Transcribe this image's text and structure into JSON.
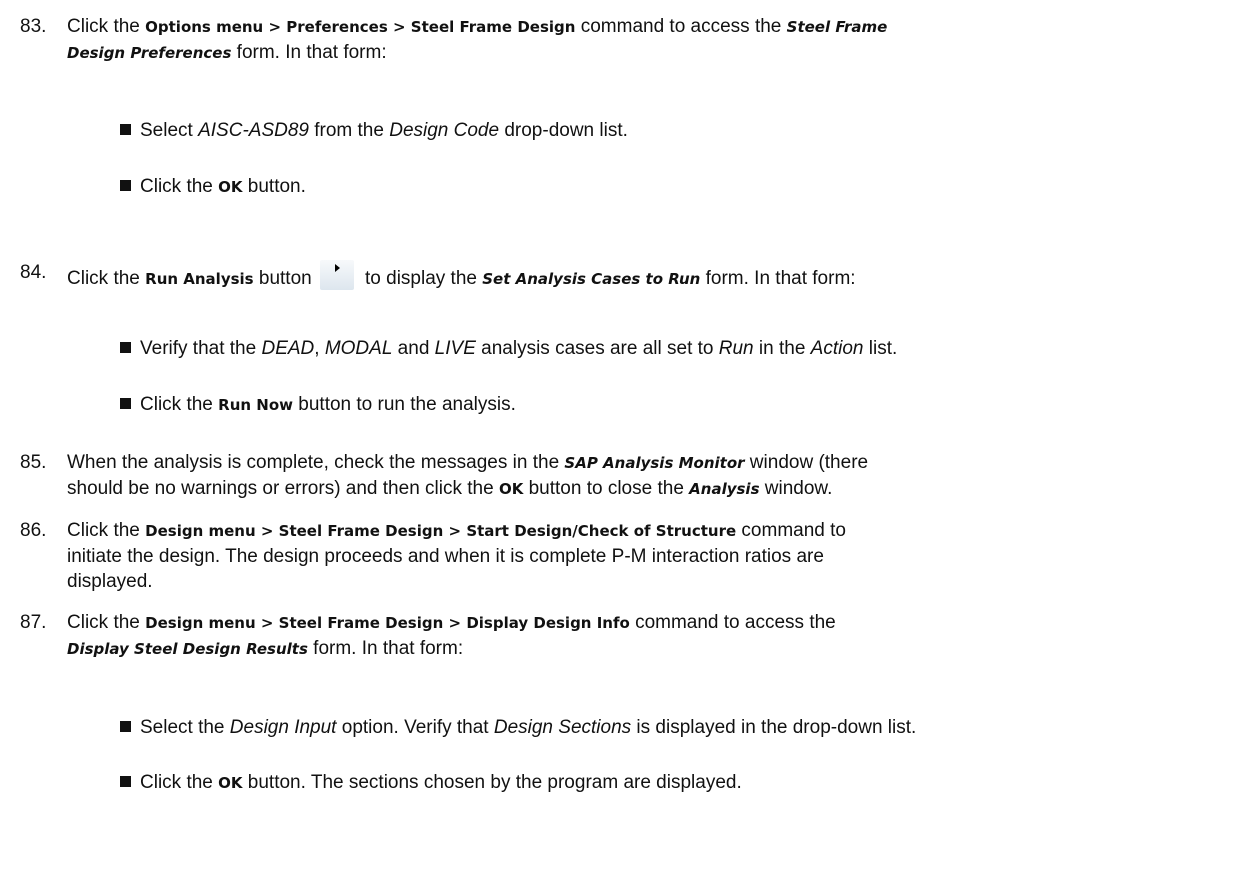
{
  "s83": {
    "num": "83.",
    "t1": "Click the ",
    "menu1": "Options menu",
    "sep1": " > ",
    "menu2": "Preferences",
    "sep2": " > ",
    "menu3": "Steel Frame Design",
    "t2": " command to access the ",
    "form1a": "Steel Frame",
    "t3": " ",
    "form1b": "Design Preferences",
    "t4": " form. In that form:",
    "b1": {
      "t1": "Select ",
      "v1": "AISC-ASD89",
      "t2": " from the ",
      "v2": "Design Code",
      "t3": " drop-down list."
    },
    "b2": {
      "t1": "Click the ",
      "btn": "OK",
      "t2": " button."
    }
  },
  "s84": {
    "num": "84.",
    "t1": "Click the ",
    "btn": "Run Analysis",
    "t2": " button",
    "icon": "run-analysis-play-icon",
    "t3": " to display the ",
    "form": "Set Analysis Cases to Run",
    "t4": " form. In that form:",
    "b1": {
      "t1": "Verify that the ",
      "v1": "DEAD",
      "t2": ", ",
      "v2": "MODAL",
      "t3": " and ",
      "v3": "LIVE",
      "t4": " analysis cases are all set to ",
      "v4": "Run",
      "t5": " in the ",
      "v5": "Action",
      "t6": " list."
    },
    "b2": {
      "t1": "Click the ",
      "btn": "Run Now",
      "t2": " button to run the analysis."
    }
  },
  "s85": {
    "num": "85.",
    "t1": "When the analysis is complete, check the messages in the ",
    "form1": "SAP Analysis Monitor",
    "t2": " window (there",
    "t3": "should be no warnings or errors) and then click the ",
    "btn": "OK",
    "t4": " button to close the ",
    "form2": "Analysis",
    "t5": " window."
  },
  "s86": {
    "num": "86.",
    "t1": "Click the ",
    "menu1": "Design menu",
    "sep1": " > ",
    "menu2": "Steel Frame Design",
    "sep2": " > ",
    "menu3": "Start Design/Check of Structure",
    "t2": " command to",
    "t3": "initiate the design. The design proceeds and when it is complete P-M interaction ratios are",
    "t4": "displayed."
  },
  "s87": {
    "num": "87.",
    "t1": "Click the ",
    "menu1": "Design menu",
    "sep1": " > ",
    "menu2": "Steel Frame Design",
    "sep2": " > ",
    "menu3": "Display Design Info",
    "t2": " command to access the",
    "form": "Display Steel Design Results",
    "t3": " form. In that form:",
    "b1": {
      "t1": "Select the ",
      "v1": "Design Input",
      "t2": " option. Verify that ",
      "v2": "Design Sections",
      "t3": " is displayed in the drop-down list."
    },
    "b2": {
      "t1": "Click the ",
      "btn": "OK",
      "t2": " button. The sections chosen by the program are displayed."
    }
  }
}
